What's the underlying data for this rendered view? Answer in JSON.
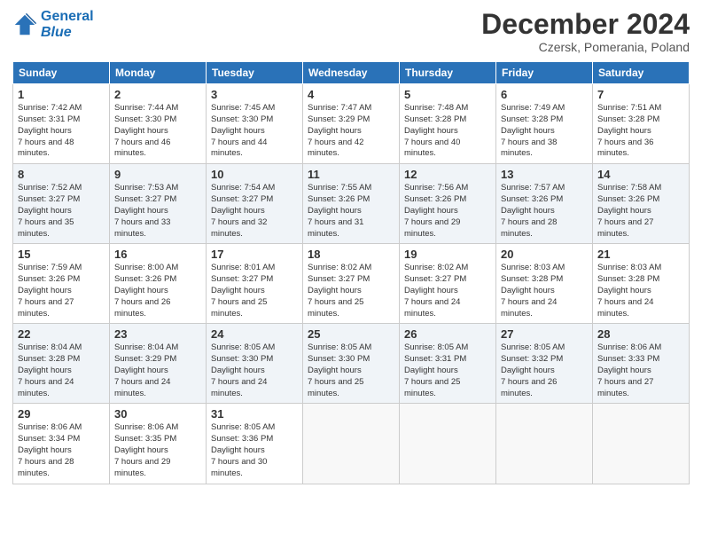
{
  "logo": {
    "line1": "General",
    "line2": "Blue"
  },
  "title": "December 2024",
  "subtitle": "Czersk, Pomerania, Poland",
  "headers": [
    "Sunday",
    "Monday",
    "Tuesday",
    "Wednesday",
    "Thursday",
    "Friday",
    "Saturday"
  ],
  "weeks": [
    [
      {
        "day": "1",
        "sunrise": "7:42 AM",
        "sunset": "3:31 PM",
        "daylight": "7 hours and 48 minutes."
      },
      {
        "day": "2",
        "sunrise": "7:44 AM",
        "sunset": "3:30 PM",
        "daylight": "7 hours and 46 minutes."
      },
      {
        "day": "3",
        "sunrise": "7:45 AM",
        "sunset": "3:30 PM",
        "daylight": "7 hours and 44 minutes."
      },
      {
        "day": "4",
        "sunrise": "7:47 AM",
        "sunset": "3:29 PM",
        "daylight": "7 hours and 42 minutes."
      },
      {
        "day": "5",
        "sunrise": "7:48 AM",
        "sunset": "3:28 PM",
        "daylight": "7 hours and 40 minutes."
      },
      {
        "day": "6",
        "sunrise": "7:49 AM",
        "sunset": "3:28 PM",
        "daylight": "7 hours and 38 minutes."
      },
      {
        "day": "7",
        "sunrise": "7:51 AM",
        "sunset": "3:28 PM",
        "daylight": "7 hours and 36 minutes."
      }
    ],
    [
      {
        "day": "8",
        "sunrise": "7:52 AM",
        "sunset": "3:27 PM",
        "daylight": "7 hours and 35 minutes."
      },
      {
        "day": "9",
        "sunrise": "7:53 AM",
        "sunset": "3:27 PM",
        "daylight": "7 hours and 33 minutes."
      },
      {
        "day": "10",
        "sunrise": "7:54 AM",
        "sunset": "3:27 PM",
        "daylight": "7 hours and 32 minutes."
      },
      {
        "day": "11",
        "sunrise": "7:55 AM",
        "sunset": "3:26 PM",
        "daylight": "7 hours and 31 minutes."
      },
      {
        "day": "12",
        "sunrise": "7:56 AM",
        "sunset": "3:26 PM",
        "daylight": "7 hours and 29 minutes."
      },
      {
        "day": "13",
        "sunrise": "7:57 AM",
        "sunset": "3:26 PM",
        "daylight": "7 hours and 28 minutes."
      },
      {
        "day": "14",
        "sunrise": "7:58 AM",
        "sunset": "3:26 PM",
        "daylight": "7 hours and 27 minutes."
      }
    ],
    [
      {
        "day": "15",
        "sunrise": "7:59 AM",
        "sunset": "3:26 PM",
        "daylight": "7 hours and 27 minutes."
      },
      {
        "day": "16",
        "sunrise": "8:00 AM",
        "sunset": "3:26 PM",
        "daylight": "7 hours and 26 minutes."
      },
      {
        "day": "17",
        "sunrise": "8:01 AM",
        "sunset": "3:27 PM",
        "daylight": "7 hours and 25 minutes."
      },
      {
        "day": "18",
        "sunrise": "8:02 AM",
        "sunset": "3:27 PM",
        "daylight": "7 hours and 25 minutes."
      },
      {
        "day": "19",
        "sunrise": "8:02 AM",
        "sunset": "3:27 PM",
        "daylight": "7 hours and 24 minutes."
      },
      {
        "day": "20",
        "sunrise": "8:03 AM",
        "sunset": "3:28 PM",
        "daylight": "7 hours and 24 minutes."
      },
      {
        "day": "21",
        "sunrise": "8:03 AM",
        "sunset": "3:28 PM",
        "daylight": "7 hours and 24 minutes."
      }
    ],
    [
      {
        "day": "22",
        "sunrise": "8:04 AM",
        "sunset": "3:28 PM",
        "daylight": "7 hours and 24 minutes."
      },
      {
        "day": "23",
        "sunrise": "8:04 AM",
        "sunset": "3:29 PM",
        "daylight": "7 hours and 24 minutes."
      },
      {
        "day": "24",
        "sunrise": "8:05 AM",
        "sunset": "3:30 PM",
        "daylight": "7 hours and 24 minutes."
      },
      {
        "day": "25",
        "sunrise": "8:05 AM",
        "sunset": "3:30 PM",
        "daylight": "7 hours and 25 minutes."
      },
      {
        "day": "26",
        "sunrise": "8:05 AM",
        "sunset": "3:31 PM",
        "daylight": "7 hours and 25 minutes."
      },
      {
        "day": "27",
        "sunrise": "8:05 AM",
        "sunset": "3:32 PM",
        "daylight": "7 hours and 26 minutes."
      },
      {
        "day": "28",
        "sunrise": "8:06 AM",
        "sunset": "3:33 PM",
        "daylight": "7 hours and 27 minutes."
      }
    ],
    [
      {
        "day": "29",
        "sunrise": "8:06 AM",
        "sunset": "3:34 PM",
        "daylight": "7 hours and 28 minutes."
      },
      {
        "day": "30",
        "sunrise": "8:06 AM",
        "sunset": "3:35 PM",
        "daylight": "7 hours and 29 minutes."
      },
      {
        "day": "31",
        "sunrise": "8:05 AM",
        "sunset": "3:36 PM",
        "daylight": "7 hours and 30 minutes."
      },
      null,
      null,
      null,
      null
    ]
  ]
}
